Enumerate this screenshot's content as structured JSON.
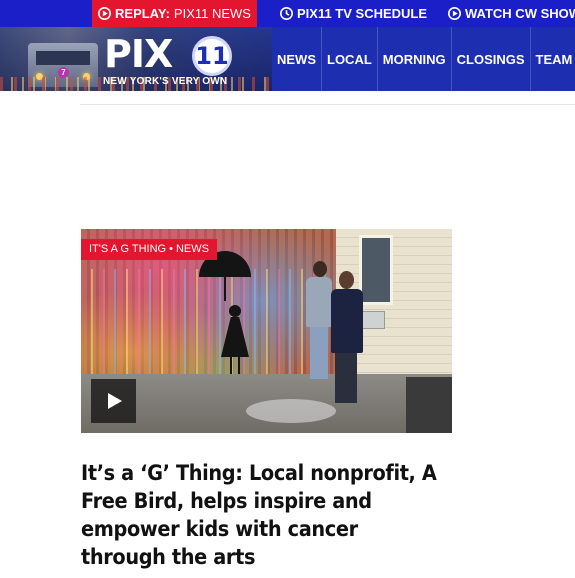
{
  "topbar": {
    "replay_strong": "REPLAY:",
    "replay_rest": "PIX11 NEWS",
    "schedule_label": "PIX11 TV SCHEDULE",
    "watch_label": "WATCH CW SHOW"
  },
  "header": {
    "logo_word": "PIX",
    "logo_badge": "11",
    "logo_tagline": "NEW YORK'S VERY OWN",
    "nav_items": [
      "NEWS",
      "LOCAL",
      "MORNING",
      "CLOSINGS",
      "TEAM"
    ]
  },
  "story": {
    "category": "IT'S A G THING",
    "separator": "•",
    "section": "NEWS",
    "headline": "It’s a ‘G’ Thing: Local nonprofit, A Free Bird, helps inspire and empower kids with cancer through the arts",
    "play_icon": "play-icon"
  },
  "colors": {
    "brand_blue": "#1a1fc7",
    "header_blue": "#1d2fb0",
    "accent_red": "#e4152e"
  }
}
